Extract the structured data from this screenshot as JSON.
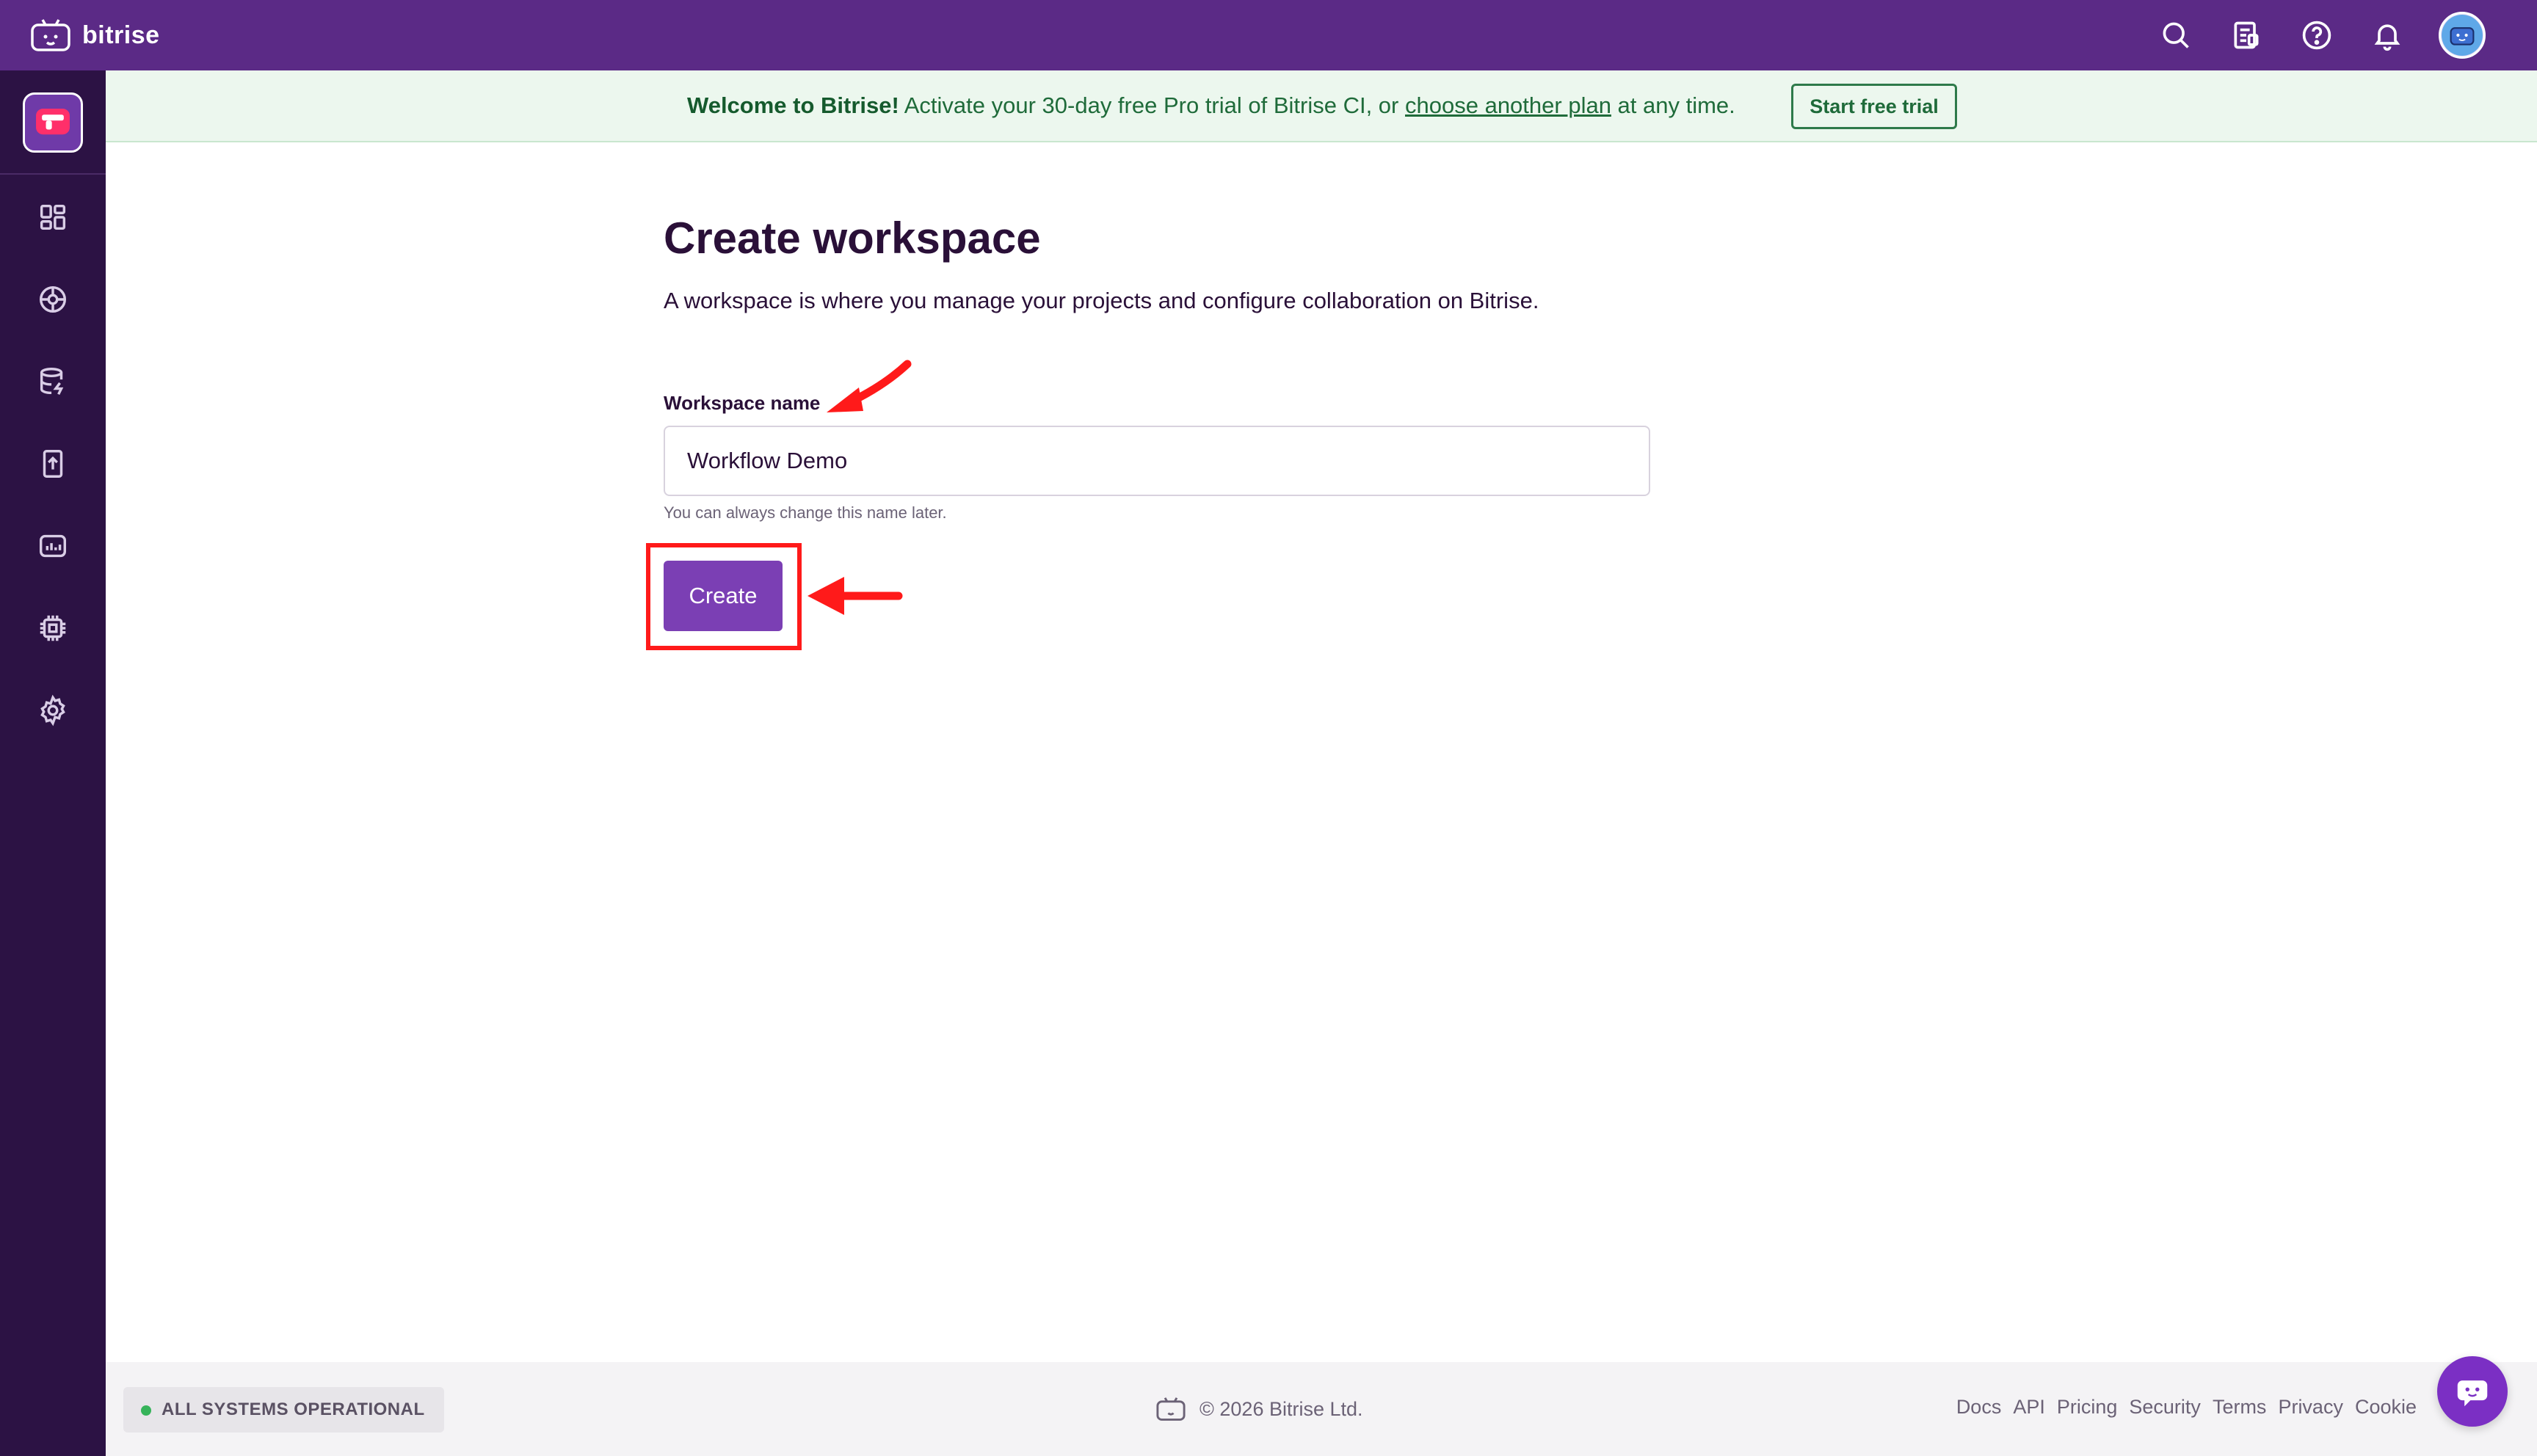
{
  "brand": {
    "name": "bitrise"
  },
  "topbar": {
    "icons": [
      "search-icon",
      "changelog-icon",
      "help-icon",
      "bell-icon",
      "avatar"
    ]
  },
  "sidebar": {
    "items": [
      "app-icon",
      "dashboard-icon",
      "builds-icon",
      "cache-icon",
      "releases-icon",
      "insights-icon",
      "chip-icon",
      "settings-icon"
    ]
  },
  "banner": {
    "welcome": "Welcome to Bitrise!",
    "text_before": " Activate your 30-day free Pro trial of Bitrise CI, or ",
    "link": "choose another plan",
    "text_after": " at any time.",
    "button": "Start free trial"
  },
  "main": {
    "title": "Create workspace",
    "description": "A workspace is where you manage your projects and configure collaboration on Bitrise.",
    "field_label": "Workspace name",
    "field_value": "Workflow Demo",
    "field_help": "You can always change this name later.",
    "create_button": "Create"
  },
  "footer": {
    "status": "ALL SYSTEMS OPERATIONAL",
    "copyright": "© 2026 Bitrise Ltd.",
    "links": [
      "Docs",
      "API",
      "Pricing",
      "Security",
      "Terms",
      "Privacy",
      "Cookie"
    ]
  },
  "colors": {
    "topbar": "#5b2a86",
    "sidebar": "#2c1244",
    "accent": "#7b3fb4",
    "banner_bg": "#ecf7ee",
    "banner_text": "#1f6b3a",
    "annotation": "#ff1a1a",
    "status_ok": "#36b35a"
  }
}
